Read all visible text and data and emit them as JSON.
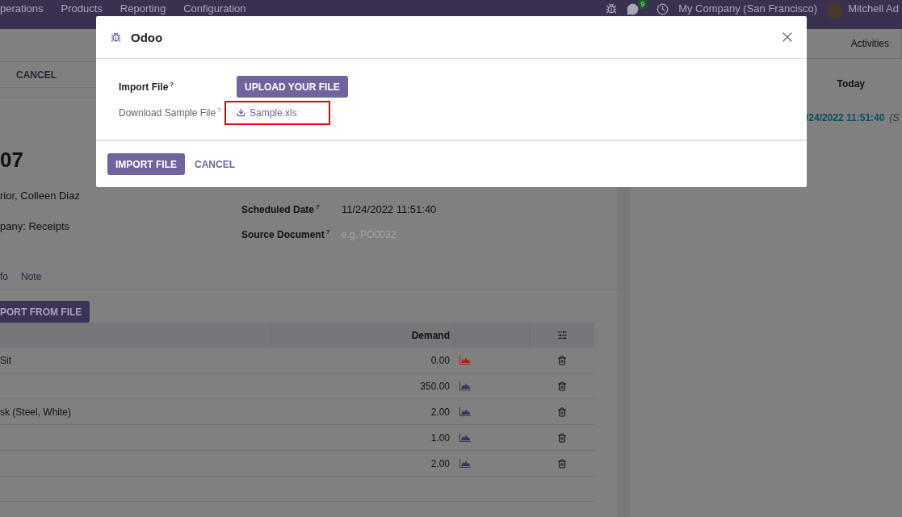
{
  "navbar": {
    "menu": [
      "perations",
      "Products",
      "Reporting",
      "Configuration"
    ],
    "chat_count": "9",
    "company": "My Company (San Francisco)",
    "user": "Mitchell Ad"
  },
  "control_panel": {
    "buttons": [
      "CANCEL"
    ]
  },
  "form": {
    "title": "07",
    "fields_left": [
      "rior, Colleen Diaz",
      "pany: Receipts"
    ],
    "fields_right": [
      {
        "label": "Scheduled Date",
        "help": "?",
        "value": "11/24/2022 11:51:40"
      },
      {
        "label": "Source Document",
        "help": "?",
        "placeholder": "e.g. PO0032"
      }
    ],
    "tabs": [
      {
        "label": "fo",
        "selected": false
      },
      {
        "label": "Note",
        "selected": false
      }
    ],
    "import_button": "PORT FROM FILE"
  },
  "table": {
    "demand_header": "Demand",
    "rows": [
      {
        "product": "Sit",
        "demand": "0.00",
        "color": "#b0201c"
      },
      {
        "demand": "350.00",
        "color": "#3d3357"
      },
      {
        "product": "sk (Steel, White)",
        "demand": "2.00",
        "color": "#3d3357"
      },
      {
        "demand": "1.00",
        "color": "#3d3357"
      },
      {
        "demand": "2.00",
        "color": "#3d3357"
      }
    ]
  },
  "chatter": {
    "tab": "Activities",
    "day": "Today",
    "entry_date": "/24/2022 11:51:40",
    "entry_note": "(S"
  },
  "dialog": {
    "title": "Odoo",
    "fields": [
      {
        "label": "Import File",
        "help": "?",
        "kind": "upload",
        "button": "UPLOAD YOUR FILE"
      },
      {
        "label": "Download Sample File",
        "help": "?",
        "kind": "download",
        "link": "Sample.xls",
        "highlighted": true
      }
    ],
    "buttons": [
      {
        "label": "IMPORT FILE",
        "kind": "primary"
      },
      {
        "label": "CANCEL",
        "kind": "link"
      }
    ]
  }
}
